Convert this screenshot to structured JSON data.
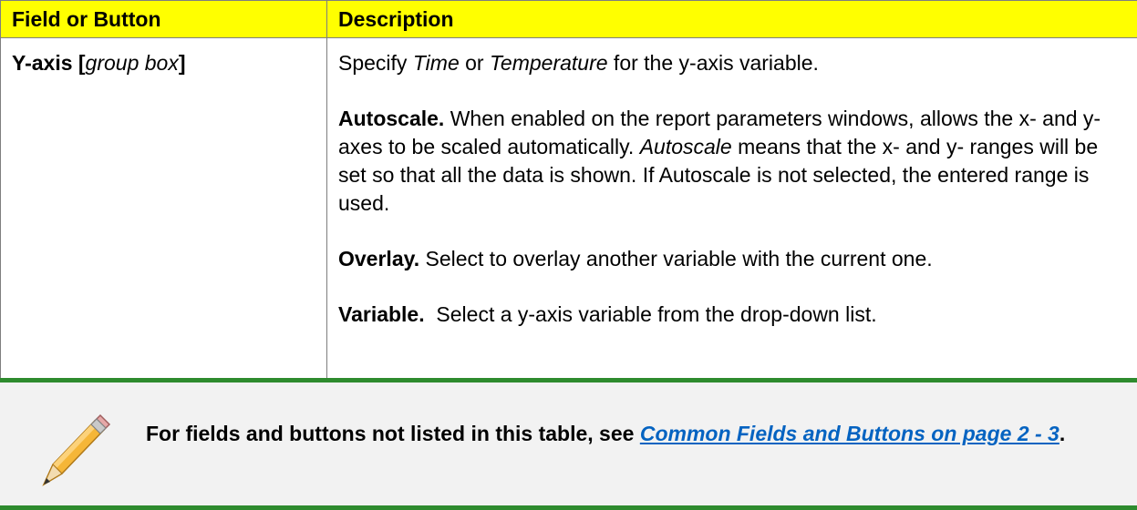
{
  "table": {
    "headers": {
      "field": "Field or Button",
      "description": "Description"
    },
    "row": {
      "field_main": "Y-axis [",
      "field_italic": "group box",
      "field_close": "]",
      "intro": {
        "pre": "Specify ",
        "time": "Time",
        "or": " or ",
        "temperature": "Temperature",
        "post": " for the y-axis variable."
      },
      "autoscale": {
        "label": "Autoscale.",
        "text1": " When enabled on the report parameters windows, allows the x- and y- axes to be scaled automatically. ",
        "italic": "Autoscale",
        "text2": " means that the x- and y- ranges will be set so that all the data is shown. If Autoscale is not selected, the entered range is used."
      },
      "overlay": {
        "label": "Overlay.",
        "text": " Select to overlay another variable with the current one."
      },
      "variable": {
        "label": "Variable.",
        "text": "  Select a y-axis variable from the drop-down list."
      }
    }
  },
  "note": {
    "icon": "pencil-icon",
    "text_pre": "For fields and buttons not listed in this table, see ",
    "link": "Common Fields and Buttons on page 2 - 3",
    "text_post": "."
  }
}
